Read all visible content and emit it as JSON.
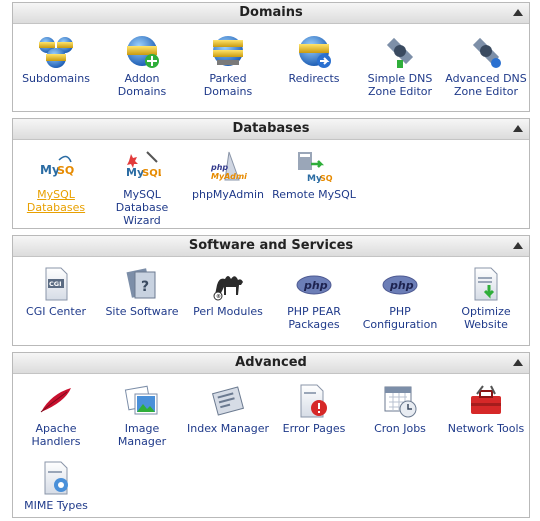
{
  "domains": {
    "title": "Domains",
    "items": [
      {
        "label": "Subdomains",
        "icon": "www-globes-icon"
      },
      {
        "label": "Addon Domains",
        "icon": "www-globe-add-icon"
      },
      {
        "label": "Parked Domains",
        "icon": "www-globe-parked-icon"
      },
      {
        "label": "Redirects",
        "icon": "www-globe-redirect-icon"
      },
      {
        "label": "Simple DNS Zone Editor",
        "icon": "dns-satellite-icon"
      },
      {
        "label": "Advanced DNS Zone Editor",
        "icon": "dns-satellite-advanced-icon"
      }
    ]
  },
  "databases": {
    "title": "Databases",
    "items": [
      {
        "label": "MySQL Databases",
        "icon": "mysql-icon",
        "active": true
      },
      {
        "label": "MySQL Database Wizard",
        "icon": "mysql-wizard-icon"
      },
      {
        "label": "phpMyAdmin",
        "icon": "phpmyadmin-icon"
      },
      {
        "label": "Remote MySQL",
        "icon": "remote-mysql-icon"
      }
    ]
  },
  "software": {
    "title": "Software and Services",
    "items": [
      {
        "label": "CGI Center",
        "icon": "cgi-icon"
      },
      {
        "label": "Site Software",
        "icon": "site-software-icon"
      },
      {
        "label": "Perl Modules",
        "icon": "perl-camel-icon"
      },
      {
        "label": "PHP PEAR Packages",
        "icon": "php-pear-icon"
      },
      {
        "label": "PHP Configuration",
        "icon": "php-config-icon"
      },
      {
        "label": "Optimize Website",
        "icon": "optimize-website-icon"
      }
    ]
  },
  "advanced": {
    "title": "Advanced",
    "items": [
      {
        "label": "Apache Handlers",
        "icon": "apache-feather-icon"
      },
      {
        "label": "Image Manager",
        "icon": "image-manager-icon"
      },
      {
        "label": "Index Manager",
        "icon": "index-manager-icon"
      },
      {
        "label": "Error Pages",
        "icon": "error-pages-icon"
      },
      {
        "label": "Cron Jobs",
        "icon": "cron-jobs-icon"
      },
      {
        "label": "Network Tools",
        "icon": "network-tools-icon"
      },
      {
        "label": "MIME Types",
        "icon": "mime-types-icon"
      }
    ]
  },
  "colors": {
    "link": "#1f3a8a",
    "active_link": "#e8a000"
  }
}
